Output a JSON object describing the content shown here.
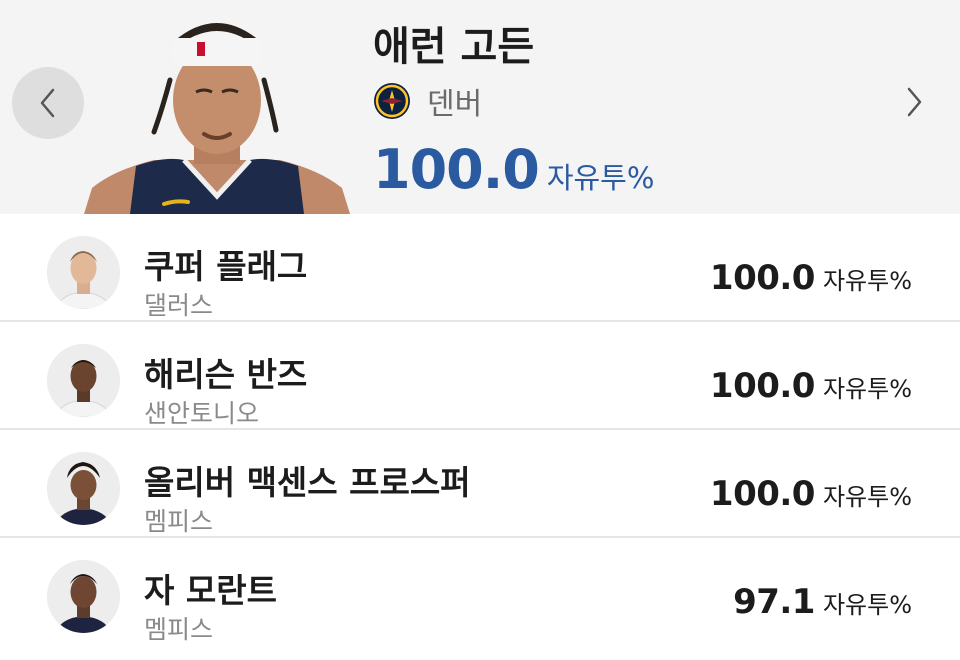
{
  "leader": {
    "name": "애런 고든",
    "team": "덴버",
    "value": "100.0",
    "stat_label": "자유투%",
    "team_logo_icon": "nuggets-logo-icon"
  },
  "nav": {
    "prev_icon": "chevron-left-icon",
    "next_icon": "chevron-right-icon"
  },
  "players": [
    {
      "name": "쿠퍼 플래그",
      "team": "댈러스",
      "value": "100.0",
      "stat_label": "자유투%"
    },
    {
      "name": "해리슨 반즈",
      "team": "샌안토니오",
      "value": "100.0",
      "stat_label": "자유투%"
    },
    {
      "name": "올리버 맥센스 프로스퍼",
      "team": "멤피스",
      "value": "100.0",
      "stat_label": "자유투%"
    },
    {
      "name": "자 모란트",
      "team": "멤피스",
      "value": "97.1",
      "stat_label": "자유투%"
    }
  ],
  "colors": {
    "accent": "#2a5aa0",
    "header_bg": "#f4f4f4",
    "divider": "#e6e6e6"
  }
}
